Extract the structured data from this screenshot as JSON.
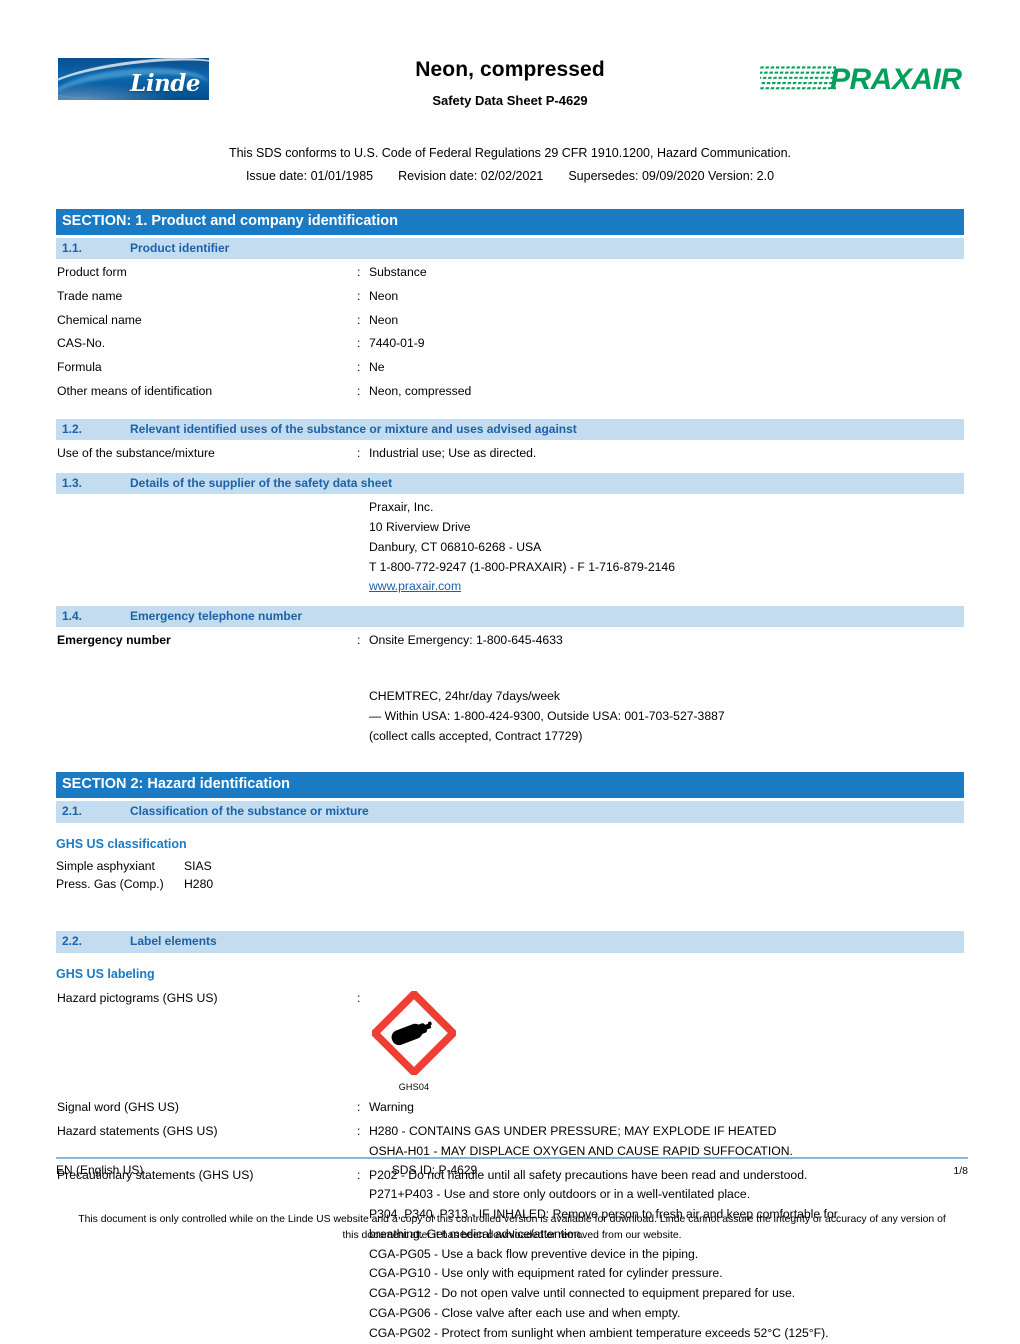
{
  "header": {
    "linde_logo_text": "Linde",
    "praxair_logo_text": "PRAXAIR",
    "title": "Neon, compressed",
    "subtitle": "Safety Data Sheet P-4629",
    "conformance": "This SDS conforms to U.S. Code of Federal Regulations 29 CFR 1910.1200, Hazard Communication.",
    "issue_date": "Issue date: 01/01/1985",
    "revision_date": "Revision date: 02/02/2021",
    "supersedes": "Supersedes: 09/09/2020 Version: 2.0"
  },
  "section1": {
    "heading": "SECTION: 1. Product and company identification",
    "sub1": {
      "num": "1.1.",
      "title": "Product identifier"
    },
    "identifier_rows": [
      {
        "label": "Product form",
        "value": "Substance"
      },
      {
        "label": "Trade name",
        "value": "Neon"
      },
      {
        "label": "Chemical name",
        "value": "Neon"
      },
      {
        "label": "CAS-No.",
        "value": "7440-01-9"
      },
      {
        "label": "Formula",
        "value": "Ne"
      },
      {
        "label": "Other means of identification",
        "value": "Neon, compressed"
      }
    ],
    "sub2": {
      "num": "1.2.",
      "title": "Relevant identified uses of the substance or mixture and uses advised against"
    },
    "use_row": {
      "label": "Use of the substance/mixture",
      "value": "Industrial use; Use as directed."
    },
    "sub3": {
      "num": "1.3.",
      "title": "Details of the supplier of the safety data sheet"
    },
    "supplier": {
      "line1": "Praxair, Inc.",
      "line2": "10 Riverview Drive",
      "line3": "Danbury, CT 06810-6268 - USA",
      "line4": "T 1-800-772-9247 (1-800-PRAXAIR) - F 1-716-879-2146",
      "website": "www.praxair.com"
    },
    "sub4": {
      "num": "1.4.",
      "title": "Emergency telephone number"
    },
    "emergency": {
      "label": "Emergency number",
      "onsite": "Onsite Emergency: 1-800-645-4633",
      "chemtrec_line1": "CHEMTREC, 24hr/day 7days/week",
      "chemtrec_line2": "— Within USA: 1-800-424-9300, Outside USA: 001-703-527-3887",
      "chemtrec_line3": "(collect calls accepted, Contract 17729)"
    }
  },
  "section2": {
    "heading": "SECTION 2: Hazard identification",
    "sub1": {
      "num": "2.1.",
      "title": "Classification of the substance or mixture"
    },
    "ghs_classification_heading": "GHS US classification",
    "classifications": [
      {
        "name": "Simple asphyxiant",
        "code": "SIAS"
      },
      {
        "name": "Press. Gas (Comp.)",
        "code": "H280"
      }
    ],
    "sub2": {
      "num": "2.2.",
      "title": "Label elements"
    },
    "ghs_labeling_heading": "GHS US labeling",
    "pictogram_row": {
      "label": "Hazard pictograms (GHS US)",
      "caption": "GHS04",
      "icon": "gas-cylinder-pictogram"
    },
    "signal_word_row": {
      "label": "Signal word (GHS US)",
      "value": "Warning"
    },
    "hazard_statements_row": {
      "label": "Hazard statements (GHS US)",
      "lines": [
        "H280 - CONTAINS GAS UNDER PRESSURE; MAY EXPLODE IF HEATED",
        "OSHA-H01 - MAY DISPLACE OXYGEN AND CAUSE RAPID SUFFOCATION."
      ]
    },
    "precautionary_row": {
      "label": "Precautionary statements (GHS US)",
      "lines": [
        "P202 - Do not handle until all safety precautions have been read and understood.",
        "P271+P403 - Use and store only outdoors or in a well-ventilated place.",
        "P304, P340, P313 - IF INHALED: Remove person to fresh air and keep comfortable for",
        "breathing.  Get medical advice/attention.",
        "CGA-PG05 - Use a back flow preventive device in the piping.",
        "CGA-PG10 - Use only with equipment rated for cylinder pressure.",
        "CGA-PG12 - Do not open valve until connected to equipment prepared for use.",
        "CGA-PG06 - Close valve after each use and when empty.",
        "CGA-PG02 - Protect from sunlight when ambient temperature exceeds 52°C (125°F)."
      ]
    }
  },
  "footer": {
    "language": "EN (English US)",
    "sds_id": "SDS ID: P-4629",
    "page": "1/8",
    "disclaimer_line1": "This document is only controlled while on the Linde US website and a copy of this controlled version is available for download. Linde cannot assure the integrity or",
    "disclaimer_line2": "accuracy of any version of this document after it has been downloaded or removed from our website."
  },
  "colors": {
    "section_bar": "#1b7ac4",
    "subsection_bar": "#c3dcf0",
    "subsection_text": "#1b62a8",
    "link": "#1c5fb4",
    "praxair_green": "#00a05a",
    "linde_blue": "#00579e",
    "pictogram_red": "#ef3e33",
    "footer_rule": "#8cb8d8"
  }
}
